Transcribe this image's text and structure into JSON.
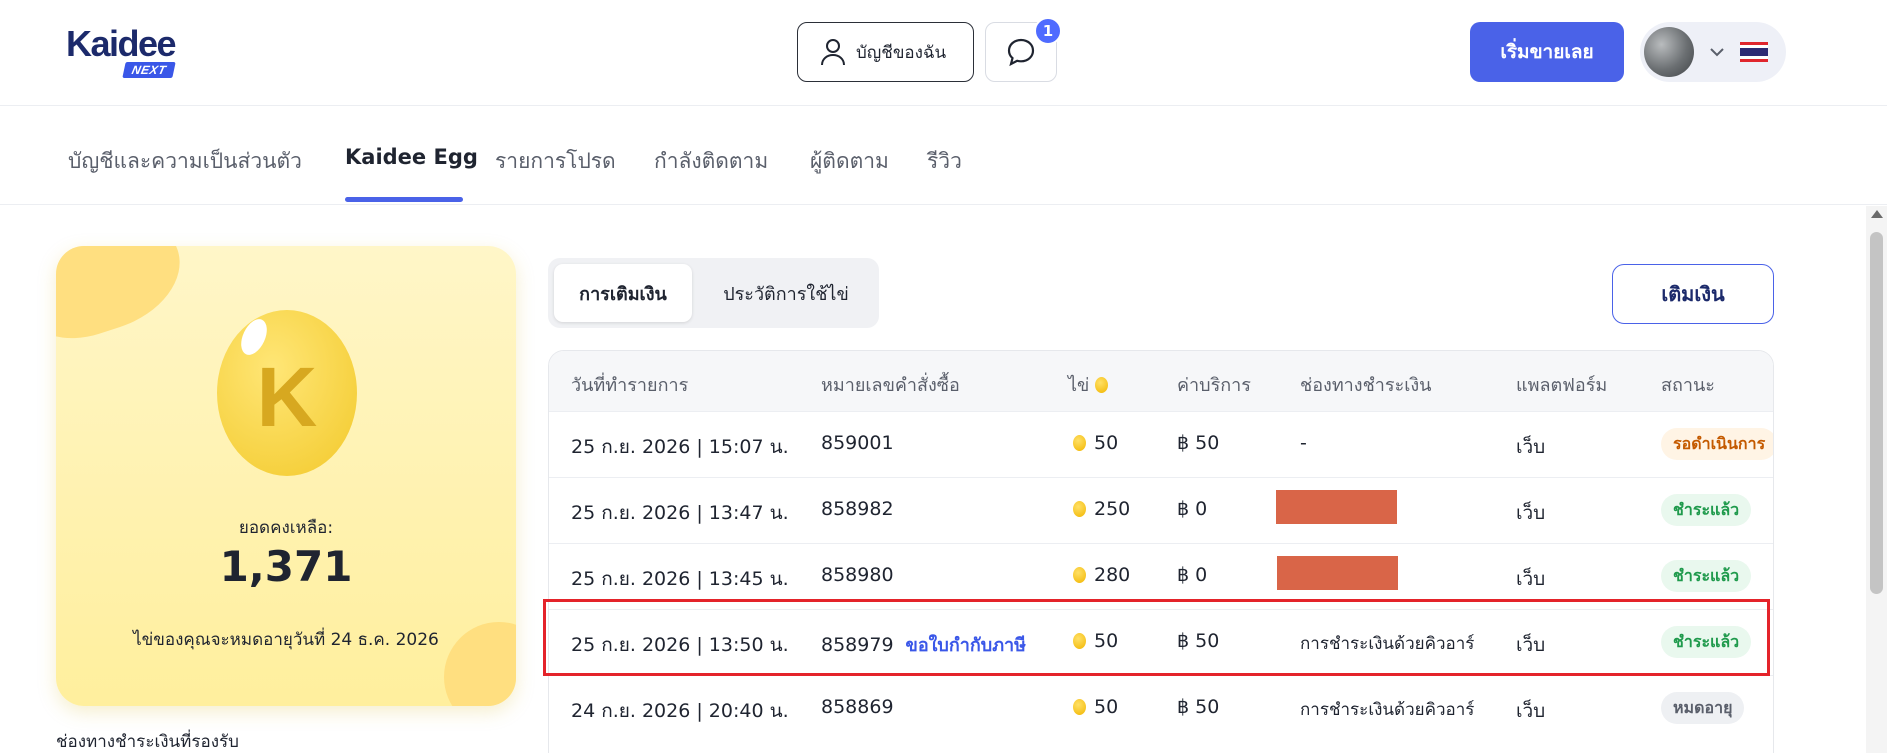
{
  "header": {
    "logo_text": "Kaidee",
    "logo_sub": "NEXT",
    "account_label": "บัญชีของฉัน",
    "chat_badge": "1",
    "sell_label": "เริ่มขายเลย"
  },
  "nav": {
    "items": [
      {
        "label": "บัญชีและความเป็นส่วนตัว"
      },
      {
        "label": "Kaidee Egg"
      },
      {
        "label": "รายการโปรด"
      },
      {
        "label": "กำลังติดตาม"
      },
      {
        "label": "ผู้ติดตาม"
      },
      {
        "label": "รีวิว"
      }
    ],
    "active": "Kaidee Egg"
  },
  "card": {
    "egg_letter": "K",
    "balance_label": "ยอดคงเหลือ:",
    "balance_value": "1,371",
    "expiry_text": "ไข่ของคุณจะหมดอายุวันที่ 24 ธ.ค. 2026"
  },
  "payment_methods_label": "ช่องทางชำระเงินที่รองรับ",
  "segments": {
    "topup": "การเติมเงิน",
    "history": "ประวัติการใช้ไข่"
  },
  "topup_button": "เติมเงิน",
  "table": {
    "headers": {
      "date": "วันที่ทำรายการ",
      "order": "หมายเลขคำสั่งซื้อ",
      "eggs": "ไข่",
      "fee": "ค่าบริการ",
      "channel": "ช่องทางชำระเงิน",
      "platform": "แพลตฟอร์ม",
      "status": "สถานะ"
    },
    "rows": [
      {
        "date": "25 ก.ย. 2026 | 15:07 น.",
        "order": "859001",
        "link": "",
        "eggs": "50",
        "fee": "฿ 50",
        "channel": "-",
        "platform": "เว็บ",
        "status": "รอดำเนินการ"
      },
      {
        "date": "25 ก.ย. 2026 | 13:47 น.",
        "order": "858982",
        "link": "",
        "eggs": "250",
        "fee": "฿ 0",
        "channel": "",
        "platform": "เว็บ",
        "status": "ชำระแล้ว"
      },
      {
        "date": "25 ก.ย. 2026 | 13:45 น.",
        "order": "858980",
        "link": "",
        "eggs": "280",
        "fee": "฿ 0",
        "channel": "",
        "platform": "เว็บ",
        "status": "ชำระแล้ว"
      },
      {
        "date": "25 ก.ย. 2026 | 13:50 น.",
        "order": "858979",
        "link": "ขอใบกำกับภาษี",
        "eggs": "50",
        "fee": "฿ 50",
        "channel": "การชำระเงินด้วยคิวอาร์",
        "platform": "เว็บ",
        "status": "ชำระแล้ว"
      },
      {
        "date": "24 ก.ย. 2026 | 20:40 น.",
        "order": "858869",
        "link": "",
        "eggs": "50",
        "fee": "฿ 50",
        "channel": "การชำระเงินด้วยคิวอาร์",
        "platform": "เว็บ",
        "status": "หมดอายุ"
      }
    ]
  },
  "colors": {
    "accent": "#4a62e8",
    "highlight": "#e4232a",
    "redaction": "#d96548"
  }
}
